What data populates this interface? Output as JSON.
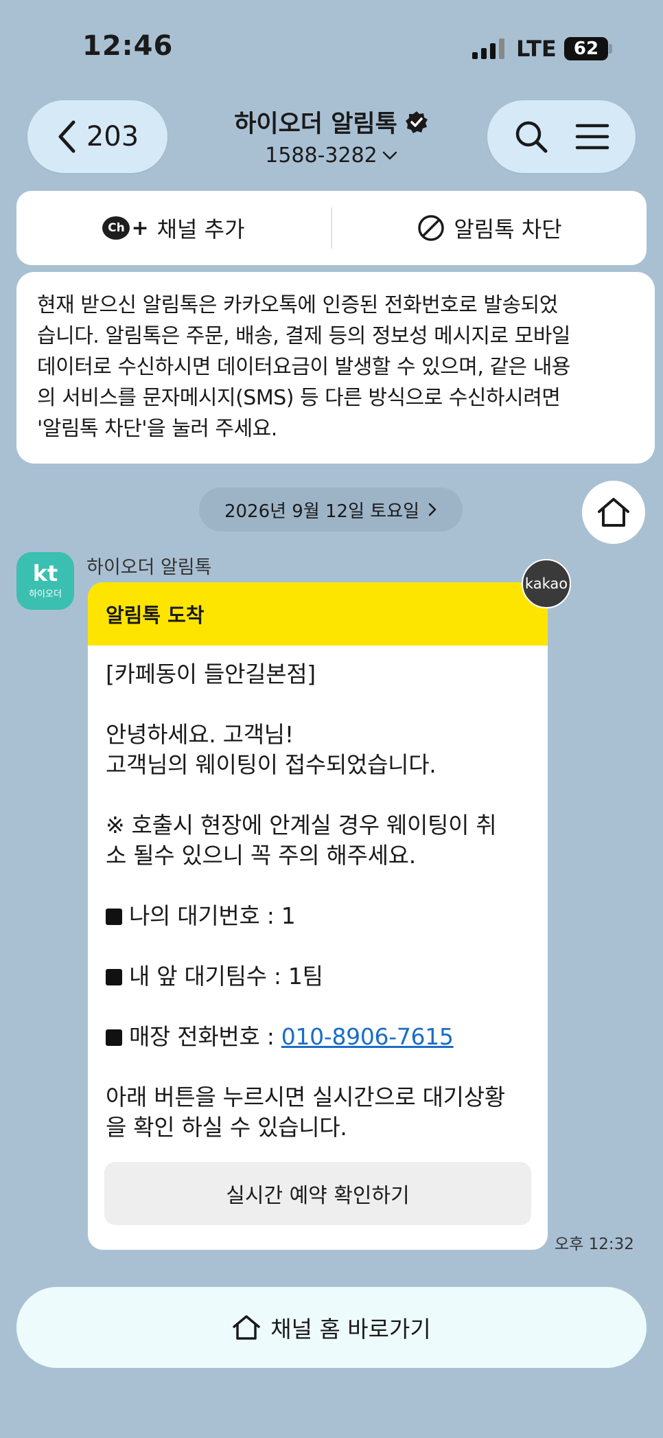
{
  "status_bar": {
    "time": "12:46",
    "network": "LTE",
    "battery": "62"
  },
  "header": {
    "back_count": "203",
    "channel_name": "하이오더 알림톡",
    "phone": "1588-3282"
  },
  "action_bar": {
    "add_channel_badge": "Ch",
    "add_channel_label": "채널 추가",
    "block_label": "알림톡 차단"
  },
  "notice": {
    "lines": [
      "현재 받으신 알림톡은 카카오톡에 인증된 전화번호로 발송되었",
      "습니다. 알림톡은 주문, 배송, 결제 등의 정보성 메시지로 모바일",
      "데이터로 수신하시면 데이터요금이 발생할 수 있으며, 같은 내용",
      "의 서비스를 문자메시지(SMS) 등 다른 방식으로 수신하시려면",
      "'알림톡 차단'을 눌러 주세요."
    ]
  },
  "date_chip": "2026년 9월 12일 토요일",
  "sender": {
    "avatar_logo": "kt",
    "avatar_sub": "하이오더",
    "name": "하이오더 알림톡"
  },
  "message": {
    "header": "알림톡 도착",
    "store": "[카페동이 들안길본점]",
    "greeting_1": "안녕하세요. 고객님!",
    "greeting_2": "고객님의 웨이팅이 접수되었습니다.",
    "warning_1": "※ 호출시 현장에 안계실 경우 웨이팅이 취",
    "warning_2": "소 될수 있으니 꼭 주의 해주세요.",
    "waiting_number": "나의 대기번호 : 1",
    "teams_ahead": "내 앞 대기팀수 : 1팀",
    "store_phone_label": "매장 전화번호 : ",
    "store_phone": "010-8906-7615",
    "realtime_1": "아래 버튼을 누르시면 실시간으로 대기상황",
    "realtime_2": "을 확인 하실 수 있습니다.",
    "cta_label": "실시간 예약 확인하기",
    "kakao_badge": "kakao",
    "time": "오후 12:32"
  },
  "bottom_button": "채널 홈 바로가기"
}
